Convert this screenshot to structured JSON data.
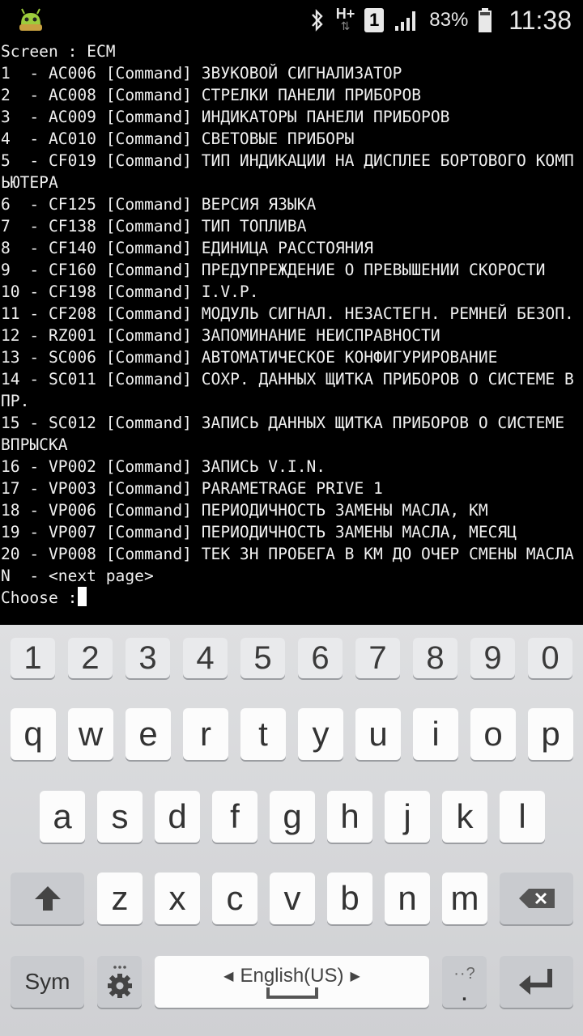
{
  "status_bar": {
    "network_type": "H+",
    "sim_slot": "1",
    "battery_percent": "83%",
    "time": "11:38",
    "icons": [
      "android-debug-icon",
      "bluetooth-icon",
      "data-arrows-icon",
      "signal-icon",
      "battery-icon"
    ]
  },
  "terminal": {
    "lines": [
      "Screen : ECM",
      "1  - AC006 [Command] ЗВУКОВОЙ СИГНАЛИЗАТОР",
      "2  - AC008 [Command] СТРЕЛКИ ПАНЕЛИ ПРИБОРОВ",
      "3  - AC009 [Command] ИНДИКАТОРЫ ПАНЕЛИ ПРИБОРОВ",
      "4  - AC010 [Command] СВЕТОВЫЕ ПРИБОРЫ",
      "5  - CF019 [Command] ТИП ИНДИКАЦИИ НА ДИСПЛЕЕ БОРТОВОГО КОМП",
      "ЬЮТЕРА",
      "6  - CF125 [Command] ВЕРСИЯ ЯЗЫКА",
      "7  - CF138 [Command] ТИП ТОПЛИВА",
      "8  - CF140 [Command] ЕДИНИЦА РАССТОЯНИЯ",
      "9  - CF160 [Command] ПРЕДУПРЕЖДЕНИЕ О ПРЕВЫШЕНИИ СКОРОСТИ",
      "10 - CF198 [Command] I.V.P.",
      "11 - CF208 [Command] МОДУЛЬ СИГНАЛ. НЕЗАСТЕГН. РЕМНЕЙ БЕЗОП.",
      "12 - RZ001 [Command] ЗАПОМИНАНИЕ НЕИСПРАВНОСТИ",
      "13 - SC006 [Command] АВТОМАТИЧЕСКОЕ КОНФИГУРИРОВАНИЕ",
      "14 - SC011 [Command] СОХР. ДАННЫХ ЩИТКА ПРИБОРОВ О СИСТЕМЕ В",
      "ПР.",
      "15 - SC012 [Command] ЗАПИСЬ ДАННЫХ ЩИТКА ПРИБОРОВ О СИСТЕМЕ",
      "ВПРЫСКА",
      "16 - VP002 [Command] ЗАПИСЬ V.I.N.",
      "17 - VP003 [Command] PARAMETRAGE PRIVE 1",
      "18 - VP006 [Command] ПЕРИОДИЧНОСТЬ ЗАМЕНЫ МАСЛА, КМ",
      "19 - VP007 [Command] ПЕРИОДИЧНОСТЬ ЗАМЕНЫ МАСЛА, МЕСЯЦ",
      "20 - VP008 [Command] ТЕК ЗН ПРОБЕГА В КМ ДО ОЧЕР СМЕНЫ МАСЛА",
      "N  - <next page>"
    ],
    "prompt": "Choose :"
  },
  "keyboard": {
    "numbers": [
      "1",
      "2",
      "3",
      "4",
      "5",
      "6",
      "7",
      "8",
      "9",
      "0"
    ],
    "row1": [
      "q",
      "w",
      "e",
      "r",
      "t",
      "y",
      "u",
      "i",
      "o",
      "p"
    ],
    "row2": [
      "a",
      "s",
      "d",
      "f",
      "g",
      "h",
      "j",
      "k",
      "l"
    ],
    "row3": [
      "z",
      "x",
      "c",
      "v",
      "b",
      "n",
      "m"
    ],
    "sym_label": "Sym",
    "language_label": "English(US)",
    "punct_hint": "?",
    "punct_key": ".",
    "colors": {
      "key_bg": "#fcfcfc",
      "fn_key_bg": "#c9cbcf",
      "board_bg": "#d8d9dc",
      "terminal_bg": "#000000"
    }
  }
}
